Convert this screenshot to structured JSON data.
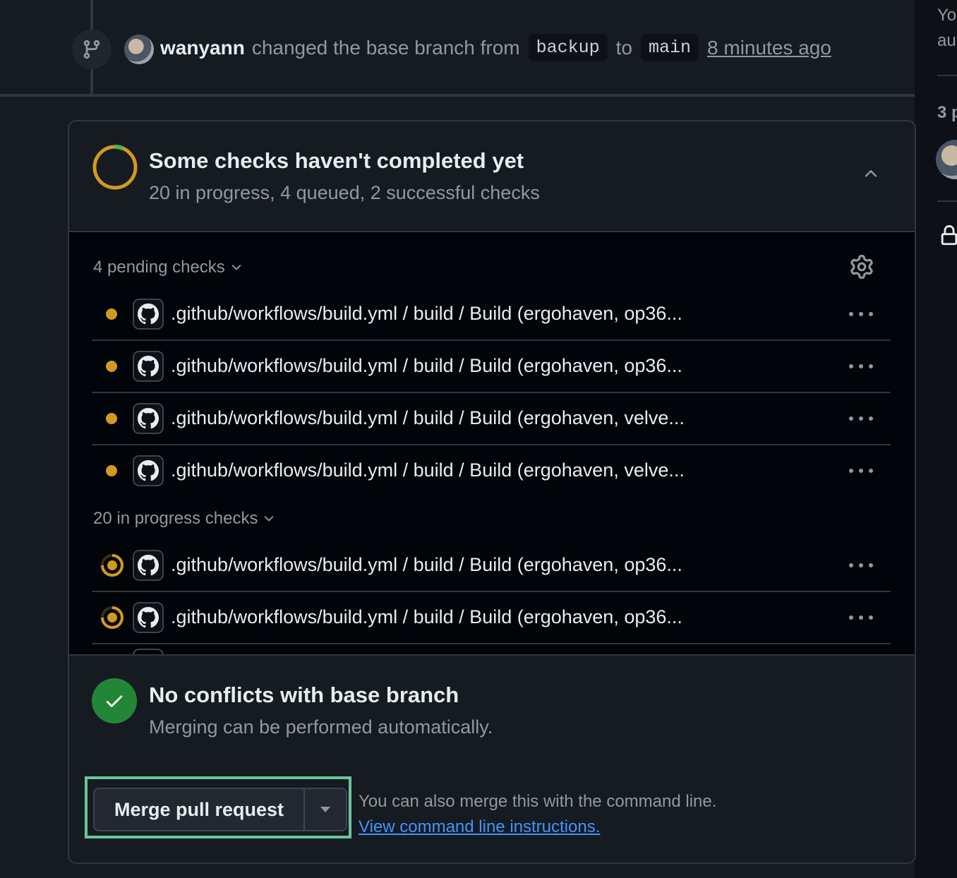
{
  "timeline_event": {
    "user": "wanyann",
    "action_text": "changed the base branch from",
    "from_branch": "backup",
    "connector": "to",
    "to_branch": "main",
    "time_ago": "8 minutes ago"
  },
  "right_rail": {
    "line1": "Yo",
    "line2": "au",
    "count_text": "3 p"
  },
  "checks": {
    "title": "Some checks haven't completed yet",
    "summary": "20 in progress, 4 queued, 2 successful checks",
    "status_color": "#d29922",
    "pending_group_label": "4 pending checks",
    "pending": [
      {
        "name": ".github/workflows/build.yml / build / Build (ergohaven, op36..."
      },
      {
        "name": ".github/workflows/build.yml / build / Build (ergohaven, op36..."
      },
      {
        "name": ".github/workflows/build.yml / build / Build (ergohaven, velve..."
      },
      {
        "name": ".github/workflows/build.yml / build / Build (ergohaven, velve..."
      }
    ],
    "in_progress_group_label": "20 in progress checks",
    "in_progress": [
      {
        "name": ".github/workflows/build.yml / build / Build (ergohaven, op36..."
      },
      {
        "name": ".github/workflows/build.yml / build / Build (ergohaven, op36..."
      }
    ]
  },
  "conflicts": {
    "title": "No conflicts with base branch",
    "subtitle": "Merging can be performed automatically.",
    "status_color": "#238636"
  },
  "merge": {
    "button_label": "Merge pull request",
    "cli_text": "You can also merge this with the command line.",
    "cli_link": "View command line instructions.",
    "highlight_color": "#69c59b"
  },
  "icons": {
    "branch": "git-branch-icon",
    "chevron_up": "chevron-up-icon",
    "chevron_down": "chevron-down-icon",
    "gear": "gear-icon",
    "github": "github-logo-icon",
    "kebab": "kebab-horizontal-icon",
    "check": "check-icon",
    "triangle_down": "triangle-down-icon",
    "lock": "lock-icon"
  }
}
